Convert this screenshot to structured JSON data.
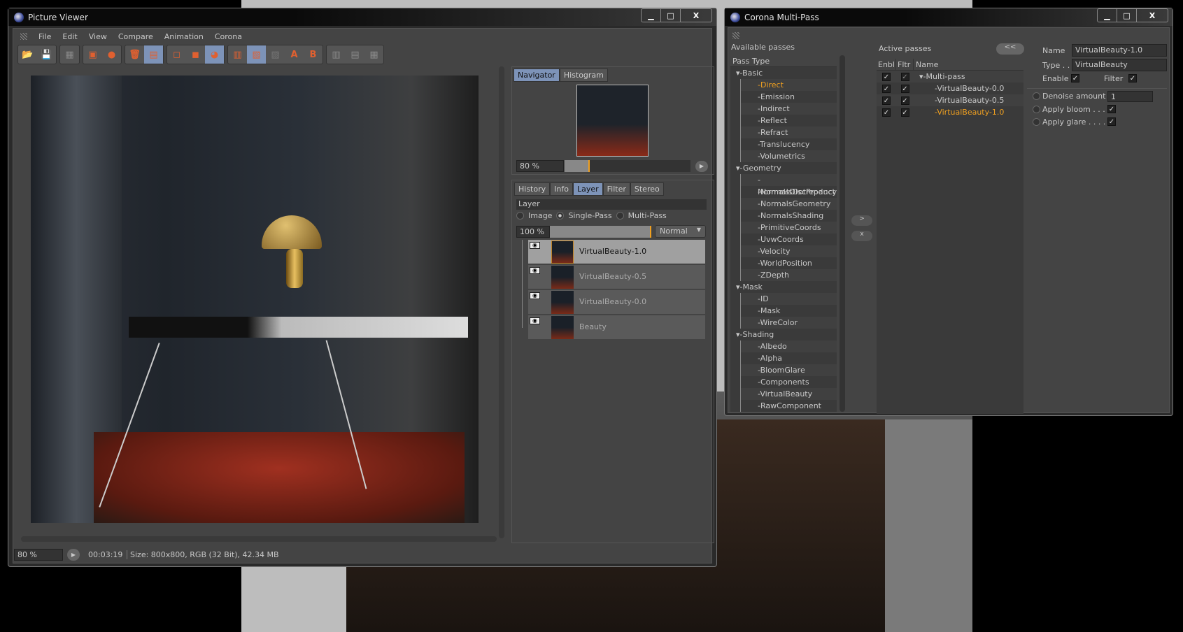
{
  "picture_viewer": {
    "title": "Picture Viewer",
    "window_buttons": [
      "minimize",
      "maximize",
      "close"
    ],
    "menu": [
      "File",
      "Edit",
      "View",
      "Compare",
      "Animation",
      "Corona"
    ],
    "toolbar_icons": [
      "open-icon",
      "save-icon",
      "render-region-icon",
      "add-to-pv-icon",
      "export-icon",
      "delete-icon",
      "copy-icon",
      "view-single-icon",
      "view-multi-icon",
      "view-eye-icon",
      "ab-compare-icon",
      "ab-split-icon",
      "ab-disabled-icon",
      "set-a-icon",
      "set-b-icon",
      "ab-side-icon",
      "ab-stack-icon",
      "ab-grid-icon"
    ],
    "toolbar_labels": {
      "a": "A",
      "b": "B"
    },
    "navigator": {
      "tabs": [
        "Navigator",
        "Histogram"
      ],
      "active": "Navigator",
      "zoom": "80 %",
      "zoom_value": 80
    },
    "tabs": [
      "History",
      "Info",
      "Layer",
      "Filter",
      "Stereo"
    ],
    "active_tab": "Layer",
    "layer": {
      "header": "Layer",
      "modes": [
        "Image",
        "Single-Pass",
        "Multi-Pass"
      ],
      "selected_mode": "Single-Pass",
      "opacity": "100 %",
      "opacity_value": 100,
      "blend": "Normal",
      "items": [
        {
          "name": "VirtualBeauty-1.0",
          "selected": true
        },
        {
          "name": "VirtualBeauty-0.5",
          "selected": false
        },
        {
          "name": "VirtualBeauty-0.0",
          "selected": false
        },
        {
          "name": "Beauty",
          "selected": false
        }
      ]
    },
    "status": {
      "zoom": "80 %",
      "time": "00:03:19",
      "info": "Size: 800x800, RGB (32 Bit), 42.34 MB"
    }
  },
  "multipass": {
    "title": "Corona Multi-Pass",
    "available_label": "Available passes",
    "pass_type_header": "Pass Type",
    "groups": [
      {
        "name": "Basic",
        "items": [
          "Direct",
          "Emission",
          "Indirect",
          "Reflect",
          "Refract",
          "Translucency",
          "Volumetrics"
        ]
      },
      {
        "name": "Geometry",
        "items": [
          "NormalsDiscrepancy",
          "NormalsDotProduct",
          "NormalsGeometry",
          "NormalsShading",
          "PrimitiveCoords",
          "UvwCoords",
          "Velocity",
          "WorldPosition",
          "ZDepth"
        ]
      },
      {
        "name": "Mask",
        "items": [
          "ID",
          "Mask",
          "WireColor"
        ]
      },
      {
        "name": "Shading",
        "items": [
          "Albedo",
          "Alpha",
          "BloomGlare",
          "Components",
          "VirtualBeauty",
          "RawComponent"
        ]
      }
    ],
    "highlighted_available": "Direct",
    "add_button": ">",
    "remove_button": "x",
    "active_label": "Active passes",
    "collapse_button": "<<",
    "active_headers": [
      "Enbl",
      "Fltr",
      "Name"
    ],
    "active_root": "Multi-pass",
    "active_items": [
      "VirtualBeauty-0.0",
      "VirtualBeauty-0.5",
      "VirtualBeauty-1.0"
    ],
    "active_selected": "VirtualBeauty-1.0",
    "props": {
      "name_label": "Name",
      "name_value": "VirtualBeauty-1.0",
      "type_label": "Type . .",
      "type_value": "VirtualBeauty",
      "enable_label": "Enable",
      "filter_label": "Filter",
      "denoise_label": "Denoise amount",
      "denoise_value": "1",
      "bloom_label": "Apply bloom . . .",
      "glare_label": "Apply glare . . . ."
    },
    "check": "✓",
    "accent": "#f0a020"
  }
}
